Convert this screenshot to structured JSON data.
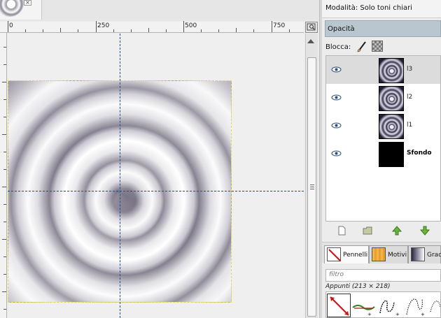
{
  "ruler": {
    "labels": [
      "0",
      "250",
      "500",
      "750"
    ]
  },
  "dock": {
    "mode_text": "Modalità: Solo toni chiari",
    "opacity_label": "Opacità",
    "lock_label": "Blocca:"
  },
  "layers": [
    {
      "name": "l3",
      "thumb": "spiral",
      "selected": true
    },
    {
      "name": "l2",
      "thumb": "spiral",
      "selected": false
    },
    {
      "name": "l1",
      "thumb": "spiral",
      "selected": false
    },
    {
      "name": "Sfondo",
      "thumb": "black",
      "selected": false
    }
  ],
  "tabs": [
    {
      "label": "Pennelli",
      "icon": "brush-icon"
    },
    {
      "label": "Motivi",
      "icon": "pattern-icon"
    },
    {
      "label": "Grad",
      "icon": "gradient-icon"
    }
  ],
  "brushes": {
    "filter_placeholder": "filtro",
    "clipboard_label": "Appunti (213 × 218)"
  },
  "colors": {
    "accent": "#b9c6cf",
    "guide": "#1e4f8f",
    "selection": "#e8d94a"
  }
}
